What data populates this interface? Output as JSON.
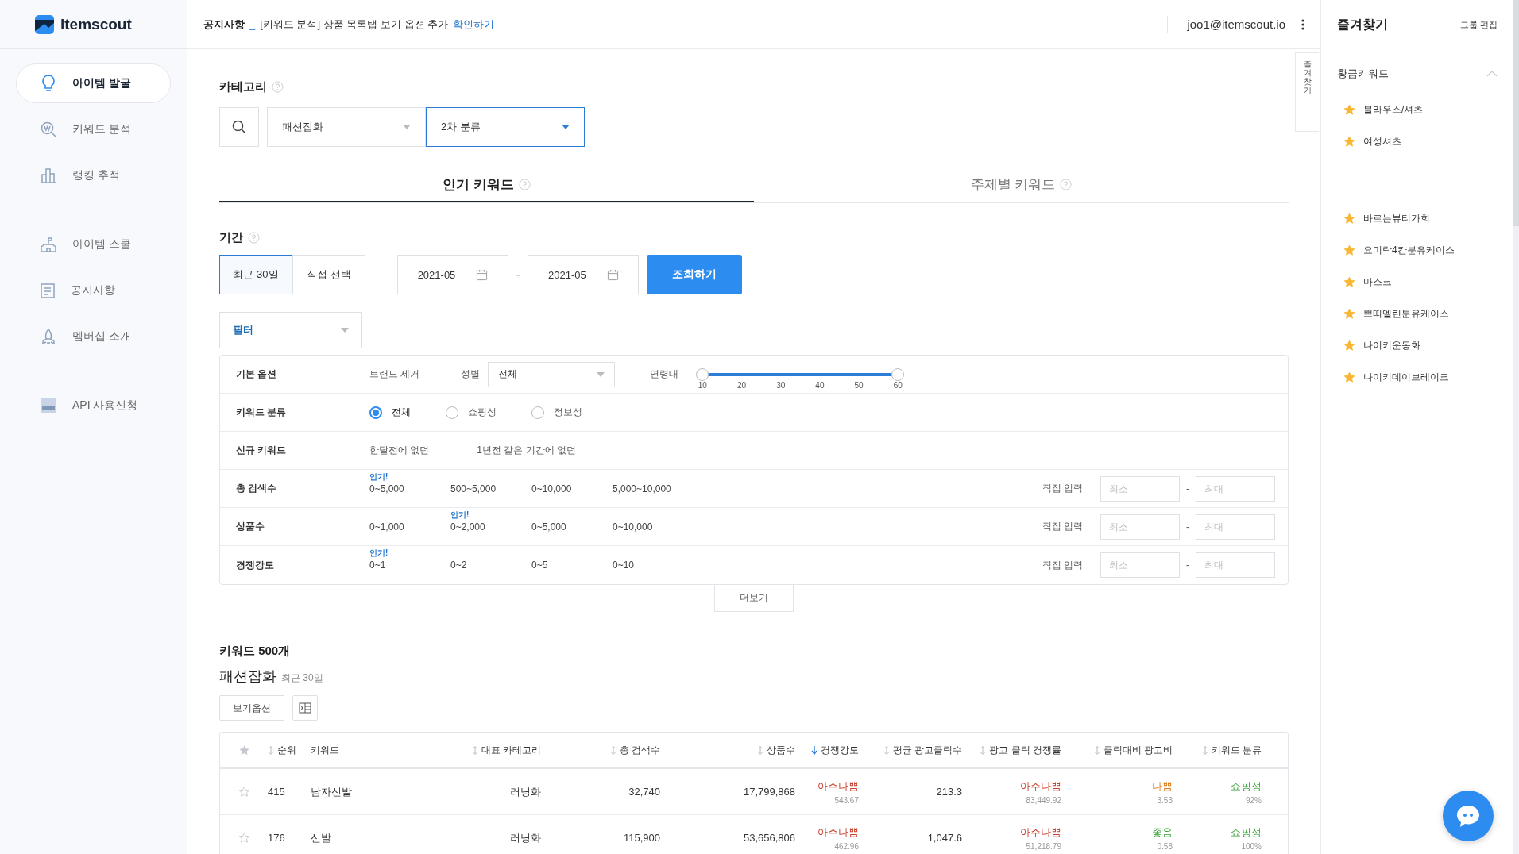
{
  "brand": {
    "name": "itemscout"
  },
  "sidebar": {
    "groups": [
      [
        {
          "label": "아이템 발굴",
          "selected": true
        },
        {
          "label": "키워드 분석",
          "selected": false
        },
        {
          "label": "랭킹 추적",
          "selected": false
        }
      ],
      [
        {
          "label": "아이템 스쿨",
          "selected": false
        },
        {
          "label": "공지사항",
          "selected": false
        },
        {
          "label": "멤버십 소개",
          "selected": false
        }
      ],
      [
        {
          "label": "API 사용신청",
          "selected": false
        }
      ]
    ]
  },
  "notice": {
    "label": "공지사항",
    "separator": "_",
    "text": "[키워드 분석] 상품 목록탭 보기 옵션 추가",
    "link": "확인하기"
  },
  "account": {
    "email": "joo1@itemscout.io"
  },
  "side_tab": {
    "label": "즐겨찾기"
  },
  "category": {
    "title": "카테고리",
    "first": "패션잡화",
    "second": "2차 분류"
  },
  "tabs": [
    {
      "label": "인기 키워드",
      "selected": true
    },
    {
      "label": "주제별 키워드",
      "selected": false
    }
  ],
  "period": {
    "title": "기간",
    "options": [
      {
        "label": "최근 30일",
        "selected": true
      },
      {
        "label": "직접 선택",
        "selected": false
      }
    ],
    "start": "2021-05",
    "dash": "-",
    "end": "2021-05",
    "submit": "조회하기"
  },
  "filter": {
    "label": "필터",
    "rows": [
      {
        "kind": "basic",
        "label": "기본 옵션",
        "brand": "브랜드 제거",
        "gender_label": "성별",
        "gender": "전체",
        "age_label": "연령대",
        "ticks": [
          "10",
          "20",
          "30",
          "40",
          "50",
          "60"
        ],
        "thumbs": [
          {
            "level": 0
          },
          {
            "level": 1
          }
        ]
      },
      {
        "kind": "radio",
        "label": "키워드 분류",
        "options": [
          {
            "label": "전체",
            "selected": true
          },
          {
            "label": "쇼핑성",
            "selected": false
          },
          {
            "label": "정보성",
            "selected": false
          }
        ]
      },
      {
        "kind": "chips",
        "label": "신규 키워드",
        "options": [
          {
            "label": "한달전에 없던"
          },
          {
            "label": "1년전 같은 기간에 없던"
          }
        ]
      },
      {
        "kind": "range",
        "label": "총 검색수",
        "options": [
          {
            "label": "0~5,000",
            "badge": "인기!"
          },
          {
            "label": "500~5,000"
          },
          {
            "label": "0~10,000"
          },
          {
            "label": "5,000~10,000"
          }
        ],
        "direct": "직접 입력",
        "min": {
          "placeholder": "최소"
        },
        "dash": "-",
        "max": {
          "placeholder": "최대"
        }
      },
      {
        "kind": "range",
        "label": "상품수",
        "options": [
          {
            "label": "0~1,000"
          },
          {
            "label": "0~2,000",
            "badge": "인기!"
          },
          {
            "label": "0~5,000"
          },
          {
            "label": "0~10,000"
          }
        ],
        "direct": "직접 입력",
        "min": {
          "placeholder": "최소"
        },
        "dash": "-",
        "max": {
          "placeholder": "최대"
        }
      },
      {
        "kind": "range",
        "label": "경쟁강도",
        "options": [
          {
            "label": "0~1",
            "badge": "인기!"
          },
          {
            "label": "0~2"
          },
          {
            "label": "0~5"
          },
          {
            "label": "0~10"
          }
        ],
        "direct": "직접 입력",
        "min": {
          "placeholder": "최소"
        },
        "dash": "-",
        "max": {
          "placeholder": "최대"
        }
      }
    ],
    "more": "더보기"
  },
  "results": {
    "count": "키워드 500개",
    "category": "패션잡화",
    "range": "최근 30일",
    "view_options": "보기옵션"
  },
  "table": {
    "columns": [
      {
        "label": "순위",
        "sorted": false
      },
      {
        "label": "키워드"
      },
      {
        "label": "대표 카테고리",
        "sorted": false
      },
      {
        "label": "총 검색수",
        "sorted": false
      },
      {
        "label": "상품수",
        "sorted": false
      },
      {
        "label": "경쟁강도",
        "sorted": true
      },
      {
        "label": "평균 광고클릭수",
        "sorted": false
      },
      {
        "label": "광고 클릭 경쟁률",
        "sorted": false
      },
      {
        "label": "클릭대비 광고비",
        "sorted": false
      },
      {
        "label": "키워드 분류",
        "sorted": false
      }
    ],
    "rows": [
      {
        "starred": false,
        "rank": "415",
        "keyword": "남자신발",
        "category": "러닝화",
        "searches": "32,740",
        "products": "17,799,868",
        "competition": {
          "grade": "아주나쁨",
          "kind": "very_bad",
          "value": "543.67"
        },
        "avg_clicks": "213.3",
        "click_competition": {
          "grade": "아주나쁨",
          "kind": "very_bad",
          "value": "83,449.92"
        },
        "cost_per_click": {
          "grade": "나쁨",
          "kind": "bad",
          "value": "3.53"
        },
        "type": {
          "grade": "쇼핑성",
          "kind": "good",
          "value": "92%"
        }
      },
      {
        "starred": false,
        "rank": "176",
        "keyword": "신발",
        "category": "러닝화",
        "searches": "115,900",
        "products": "53,656,806",
        "competition": {
          "grade": "아주나쁨",
          "kind": "very_bad",
          "value": "462.96"
        },
        "avg_clicks": "1,047.6",
        "click_competition": {
          "grade": "아주나쁨",
          "kind": "very_bad",
          "value": "51,218.79"
        },
        "cost_per_click": {
          "grade": "좋음",
          "kind": "good",
          "value": "0.58"
        },
        "type": {
          "grade": "쇼핑성",
          "kind": "good",
          "value": "100%"
        }
      }
    ]
  },
  "favorites": {
    "title": "즐겨찾기",
    "edit": "그룹 편집",
    "group": {
      "title": "황금키워드",
      "expanded": true,
      "items": [
        "블라우스/셔츠",
        "여성셔츠"
      ]
    },
    "items": [
      "바르는뷰티가희",
      "요미락4칸분유케이스",
      "마스크",
      "쁘띠엘린분유케이스",
      "나이키운동화",
      "나이키데이브레이크"
    ]
  }
}
